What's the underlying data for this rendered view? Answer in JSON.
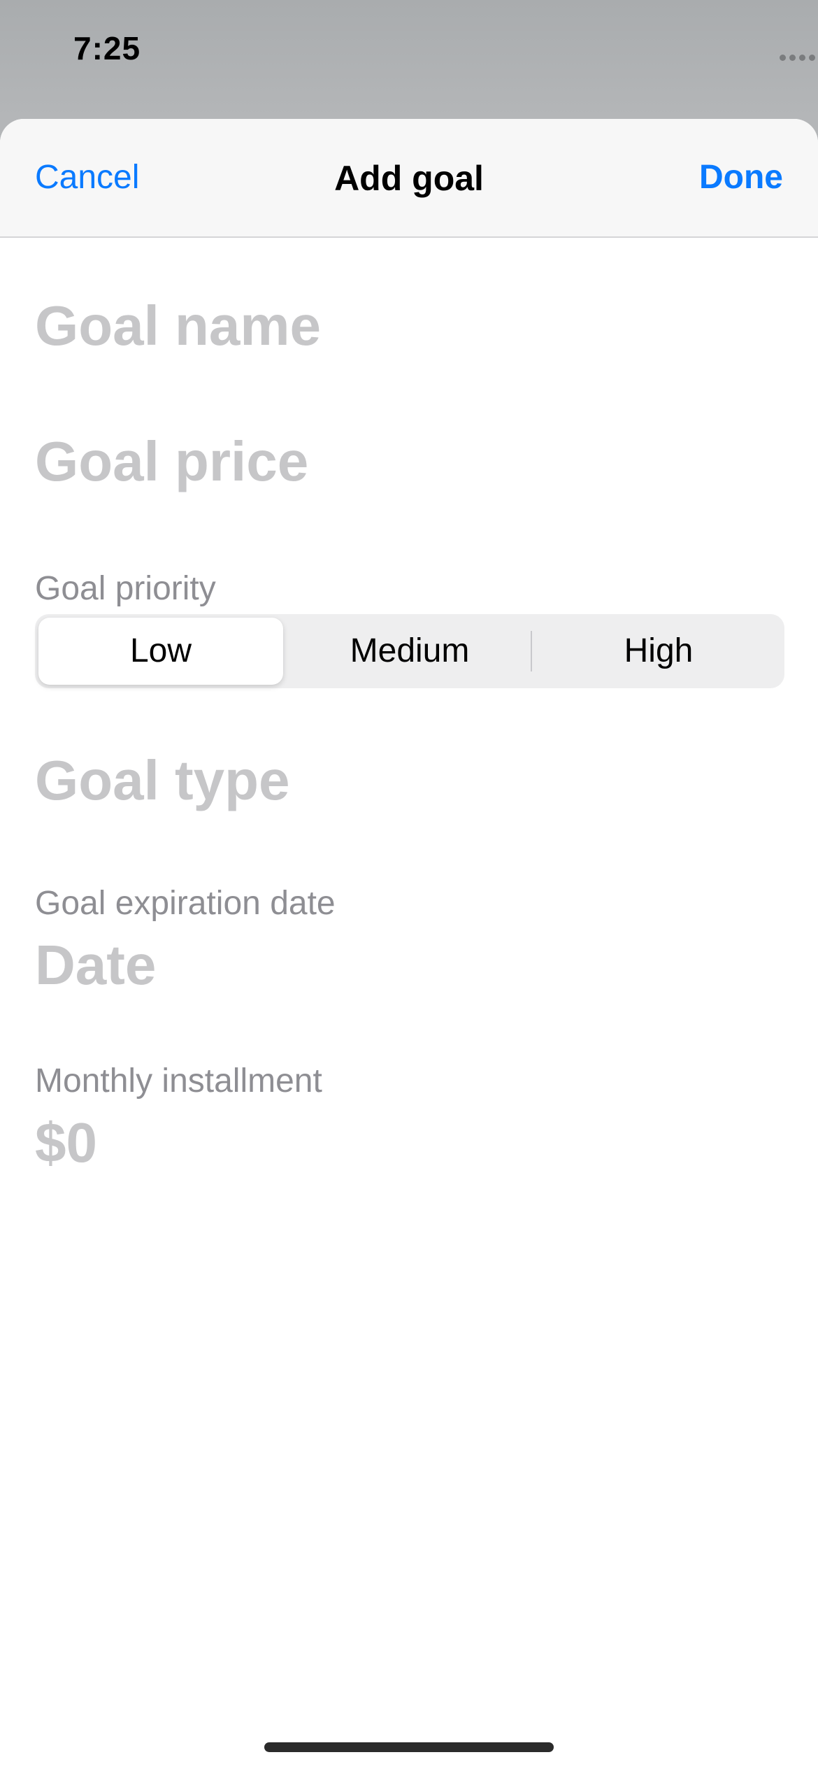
{
  "status_bar": {
    "time": "7:25"
  },
  "nav": {
    "cancel_label": "Cancel",
    "title": "Add goal",
    "done_label": "Done"
  },
  "form": {
    "goal_name": {
      "placeholder": "Goal name",
      "value": ""
    },
    "goal_price": {
      "placeholder": "Goal price",
      "value": ""
    },
    "priority": {
      "label": "Goal priority",
      "options": [
        "Low",
        "Medium",
        "High"
      ],
      "selected": "Low"
    },
    "goal_type": {
      "placeholder": "Goal type",
      "value": ""
    },
    "expiration": {
      "label": "Goal expiration date",
      "placeholder": "Date"
    },
    "monthly": {
      "label": "Monthly installment",
      "value": "$0"
    }
  },
  "colors": {
    "accent": "#0a7aff",
    "placeholder": "#c6c6c8",
    "caption": "#8e8e93",
    "segment_track": "#eeeeef",
    "backdrop": "#b4b6b8"
  },
  "icons": [
    "signal-dots-icon",
    "wifi-icon",
    "battery-icon"
  ]
}
